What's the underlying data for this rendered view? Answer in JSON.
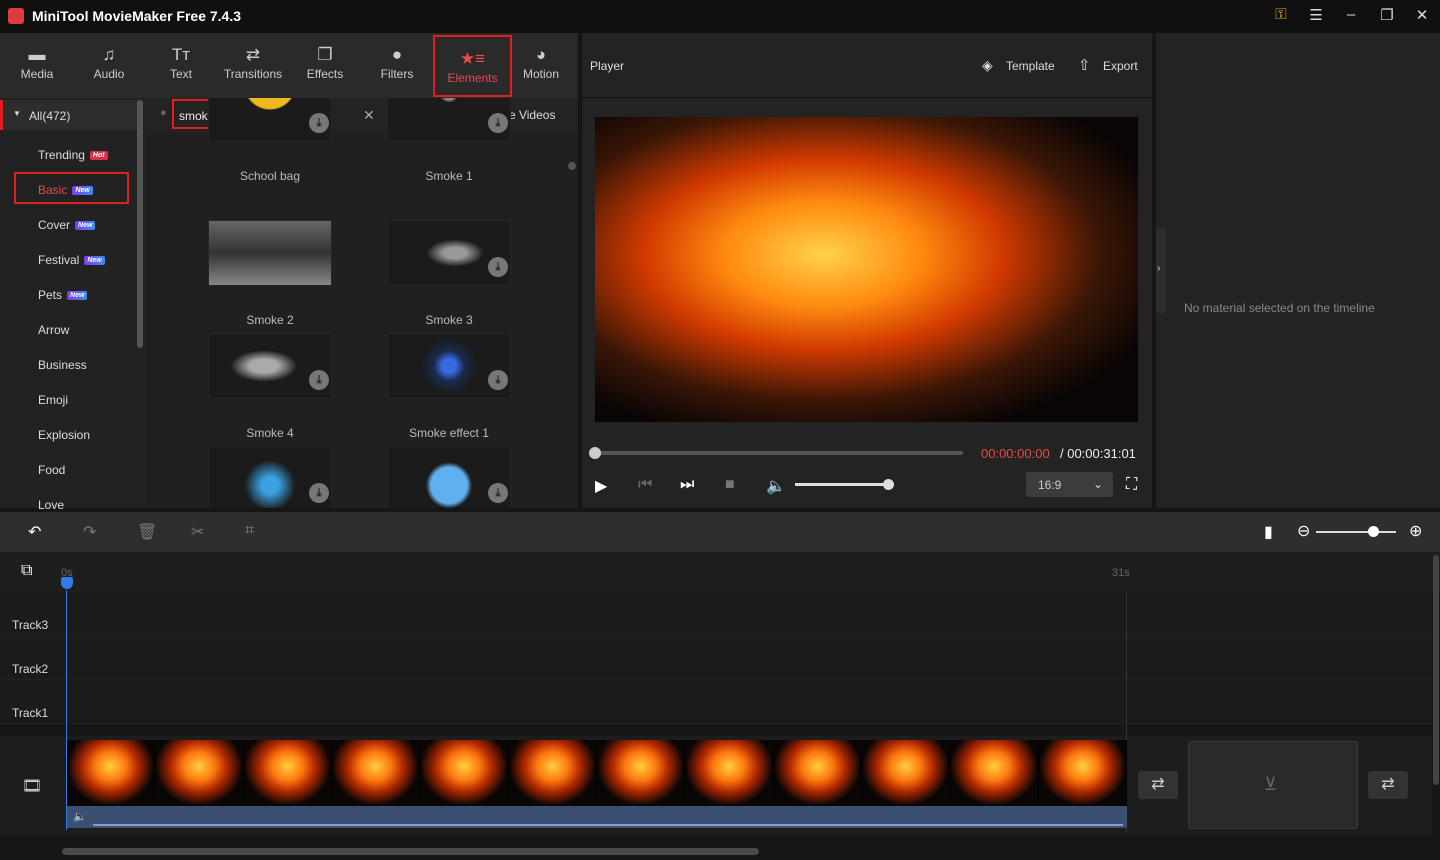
{
  "app": {
    "title": "MiniTool MovieMaker Free 7.4.3"
  },
  "toolbar": [
    {
      "label": "Media",
      "icon": "folder-icon"
    },
    {
      "label": "Audio",
      "icon": "music-icon"
    },
    {
      "label": "Text",
      "icon": "text-icon"
    },
    {
      "label": "Transitions",
      "icon": "transitions-icon"
    },
    {
      "label": "Effects",
      "icon": "effects-icon"
    },
    {
      "label": "Filters",
      "icon": "filters-icon"
    },
    {
      "label": "Elements",
      "icon": "elements-icon",
      "active": true
    },
    {
      "label": "Motion",
      "icon": "motion-icon"
    }
  ],
  "categories": {
    "all": "All(472)",
    "items": [
      {
        "label": "Trending",
        "badge": "Hot"
      },
      {
        "label": "Basic",
        "badge": "New",
        "active": true
      },
      {
        "label": "Cover",
        "badge": "New"
      },
      {
        "label": "Festival",
        "badge": "New"
      },
      {
        "label": "Pets",
        "badge": "New"
      },
      {
        "label": "Arrow"
      },
      {
        "label": "Business"
      },
      {
        "label": "Emoji"
      },
      {
        "label": "Explosion"
      },
      {
        "label": "Food"
      },
      {
        "label": "Love"
      }
    ]
  },
  "search": {
    "value": "smoke",
    "download_link": "Download YouTube Videos"
  },
  "elements": [
    {
      "label": "School bag"
    },
    {
      "label": "Smoke 1"
    },
    {
      "label": "Smoke 2"
    },
    {
      "label": "Smoke 3"
    },
    {
      "label": "Smoke 4"
    },
    {
      "label": "Smoke effect 1"
    },
    {
      "label": ""
    },
    {
      "label": ""
    }
  ],
  "player": {
    "title": "Player",
    "template": "Template",
    "export": "Export",
    "current_time": "00:00:00:00",
    "total_time": "/ 00:00:31:01",
    "aspect": "16:9",
    "progress": 0,
    "volume": 1.0
  },
  "properties": {
    "empty": "No material selected on the timeline"
  },
  "timeline": {
    "ruler_start": "0s",
    "ruler_end": "31s",
    "tracks": [
      "Track3",
      "Track2",
      "Track1"
    ],
    "zoom": 0.8
  },
  "colors": {
    "accent": "#e02020",
    "time_current": "#e84a4a"
  }
}
